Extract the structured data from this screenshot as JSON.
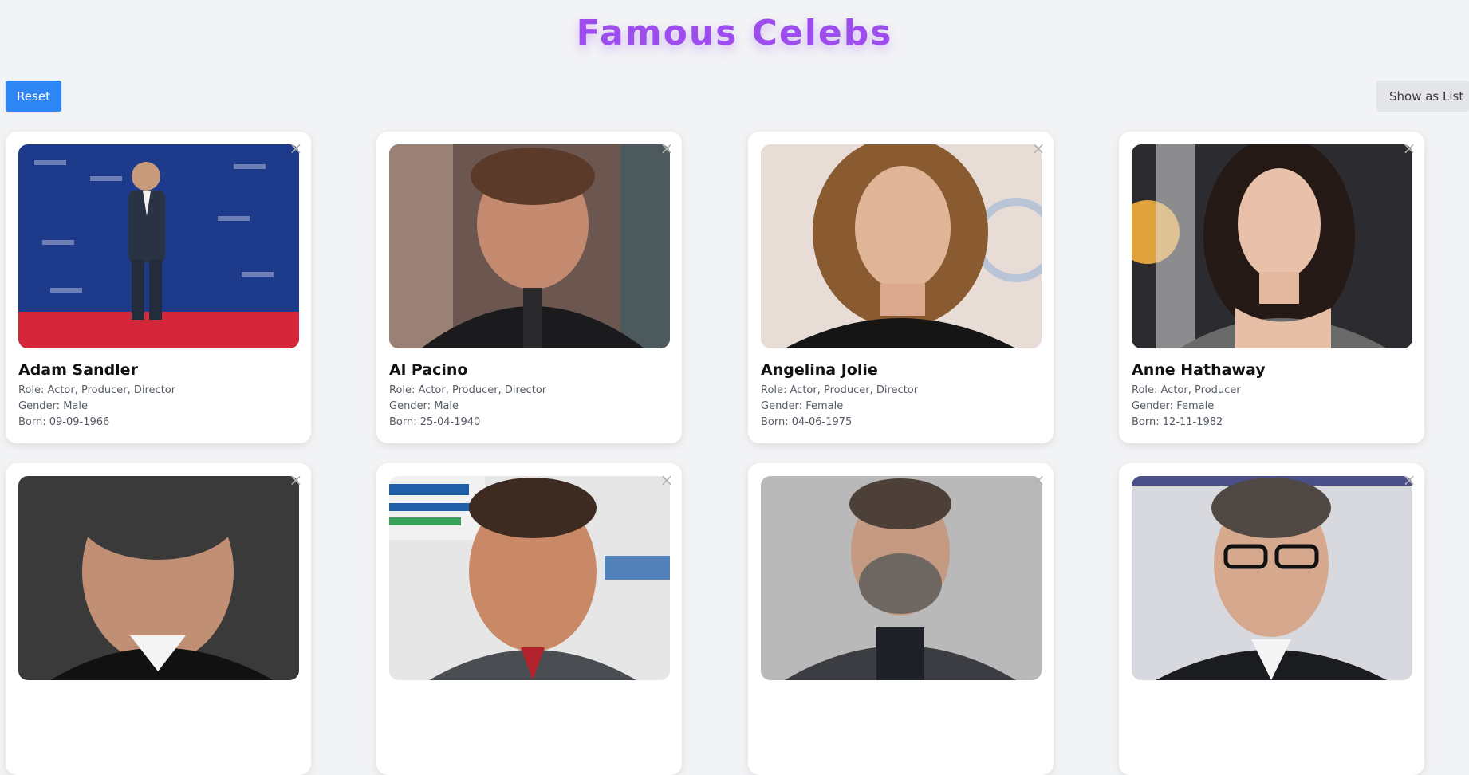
{
  "page_title": "Famous Celebs",
  "toolbar": {
    "reset_label": "Reset",
    "view_toggle_label": "Show as List"
  },
  "close_glyph": "×",
  "accent_color": "#9d4ded",
  "reset_color": "#2e86f5",
  "celebs": [
    {
      "name": "Adam Sandler",
      "role": "Role: Actor, Producer, Director",
      "gender": "Gender: Male",
      "born": "Born: 09-09-1966",
      "photo_icon": "person-photo-icon"
    },
    {
      "name": "Al Pacino",
      "role": "Role: Actor, Producer, Director",
      "gender": "Gender: Male",
      "born": "Born: 25-04-1940",
      "photo_icon": "person-photo-icon"
    },
    {
      "name": "Angelina Jolie",
      "role": "Role: Actor, Producer, Director",
      "gender": "Gender: Female",
      "born": "Born: 04-06-1975",
      "photo_icon": "person-photo-icon"
    },
    {
      "name": "Anne Hathaway",
      "role": "Role: Actor, Producer",
      "gender": "Gender: Female",
      "born": "Born: 12-11-1982",
      "photo_icon": "person-photo-icon"
    },
    {
      "name": "",
      "role": "",
      "gender": "",
      "born": "",
      "photo_icon": "person-photo-icon"
    },
    {
      "name": "",
      "role": "",
      "gender": "",
      "born": "",
      "photo_icon": "person-photo-icon"
    },
    {
      "name": "",
      "role": "",
      "gender": "",
      "born": "",
      "photo_icon": "person-photo-icon"
    },
    {
      "name": "",
      "role": "",
      "gender": "",
      "born": "",
      "photo_icon": "person-photo-icon"
    }
  ]
}
